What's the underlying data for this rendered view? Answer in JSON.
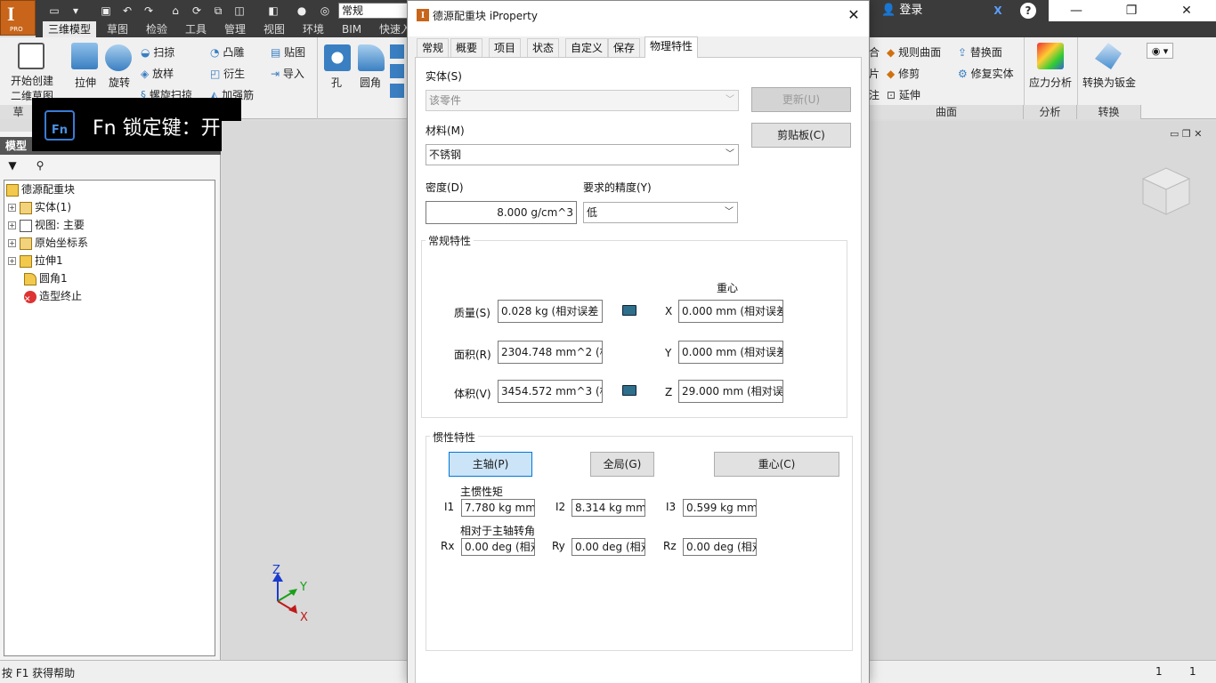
{
  "app": {
    "title_combo": "常规",
    "login": "登录",
    "pro_badge": "PRO"
  },
  "ribbon_tabs": [
    {
      "label": "三维模型",
      "active": true
    },
    {
      "label": "草图"
    },
    {
      "label": "检验"
    },
    {
      "label": "工具"
    },
    {
      "label": "管理"
    },
    {
      "label": "视图"
    },
    {
      "label": "环境"
    },
    {
      "label": "BIM"
    },
    {
      "label": "快速入"
    }
  ],
  "ribbon": {
    "create_sketch_1": "开始创建",
    "create_sketch_2": "二维草图",
    "extrude": "拉伸",
    "revolve": "旋转",
    "sweep": "扫掠",
    "loft": "放样",
    "coil": "螺旋扫掠",
    "emboss": "凸雕",
    "derive": "衍生",
    "rib": "加强筋",
    "decal": "贴图",
    "import": "导入",
    "hole": "孔",
    "fillet": "圆角",
    "ruled_surface": "规则曲面",
    "trim": "修剪",
    "extend": "延伸",
    "replace_face": "替换面",
    "repair_bodies": "修复实体",
    "stress_analysis": "应力分析",
    "convert_sheet_metal": "转换为钣金",
    "panel_sketch": "草",
    "panel_surface": "曲面",
    "panel_analysis": "分析",
    "panel_convert": "转换",
    "surface_left_1": "合",
    "surface_left_2": "片",
    "surface_left_3": "注"
  },
  "fn_overlay": {
    "key": "Fn",
    "text": "Fn 锁定键：开"
  },
  "browser": {
    "title": "模型",
    "tree": [
      {
        "label": "德源配重块",
        "level": 0,
        "icon": "part-icon"
      },
      {
        "label": "实体(1)",
        "level": 1,
        "icon": "folder-icon"
      },
      {
        "label": "视图: 主要",
        "level": 1,
        "icon": "view-icon"
      },
      {
        "label": "原始坐标系",
        "level": 1,
        "icon": "folder-icon"
      },
      {
        "label": "拉伸1",
        "level": 1,
        "icon": "extrude-icon"
      },
      {
        "label": "圆角1",
        "level": 1,
        "icon": "fillet-icon"
      },
      {
        "label": "造型终止",
        "level": 1,
        "icon": "end-of-part-icon"
      }
    ]
  },
  "axis": {
    "z": "Z",
    "y": "Y",
    "x": "X"
  },
  "statusbar": {
    "help": "按 F1 获得帮助",
    "count1": "1",
    "count2": "1"
  },
  "dialog": {
    "title": "德源配重块 iProperty",
    "tabs": [
      {
        "label": "常规"
      },
      {
        "label": "概要"
      },
      {
        "label": "项目"
      },
      {
        "label": "状态"
      },
      {
        "label": "自定义"
      },
      {
        "label": "保存"
      },
      {
        "label": "物理特性",
        "active": true
      }
    ],
    "solid_label": "实体(S)",
    "solid_value": "该零件",
    "update_button": "更新(U)",
    "clipboard_button": "剪贴板(C)",
    "material_label": "材料(M)",
    "material_value": "不锈钢",
    "density_label": "密度(D)",
    "density_value": "8.000 g/cm^3",
    "accuracy_label": "要求的精度(Y)",
    "accuracy_value": "低",
    "general_group": "常规特性",
    "cog_label": "重心",
    "mass_label": "质量(S)",
    "mass_value": "0.028 kg (相对误差 =",
    "area_label": "面积(R)",
    "area_value": "2304.748 mm^2 (相",
    "volume_label": "体积(V)",
    "volume_value": "3454.572 mm^3 (相",
    "x_label": "X",
    "x_value": "0.000 mm (相对误差",
    "y_label": "Y",
    "y_value": "0.000 mm (相对误差",
    "z_label": "Z",
    "z_value": "29.000 mm (相对误差",
    "inertia_group": "惯性特性",
    "principal_button": "主轴(P)",
    "global_button": "全局(G)",
    "cog_button": "重心(C)",
    "principal_moments": "主惯性矩",
    "i1_label": "I1",
    "i1_value": "7.780 kg mm^",
    "i2_label": "I2",
    "i2_value": "8.314 kg mm^",
    "i3_label": "I3",
    "i3_value": "0.599 kg mm^",
    "rotation_label": "相对于主轴转角",
    "rx_label": "Rx",
    "rx_value": "0.00 deg (相对",
    "ry_label": "Ry",
    "ry_value": "0.00 deg (相对",
    "rz_label": "Rz",
    "rz_value": "0.00 deg (相对"
  }
}
